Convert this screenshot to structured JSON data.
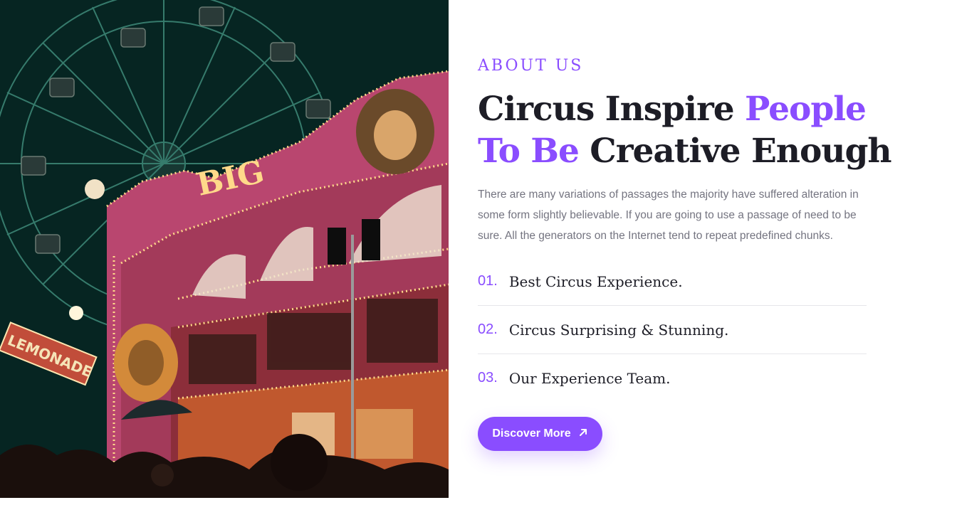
{
  "about": {
    "eyebrow": "ABOUT US",
    "heading_part1": "Circus Inspire ",
    "heading_accent1": "People",
    "heading_accent2": "To Be",
    "heading_part2": " Creative Enough",
    "description": "There are many variations of passages the majority have suffered alteration in some form slightly believable. If you are going to use a passage of need to be sure. All the generators on the Internet tend to repeat predefined chunks.",
    "items": [
      {
        "num": "01.",
        "label": "Best Circus Experience."
      },
      {
        "num": "02.",
        "label": "Circus Surprising & Stunning."
      },
      {
        "num": "03.",
        "label": "Our Experience Team."
      }
    ],
    "button_label": "Discover More",
    "button_icon": "arrow-up-right-icon"
  },
  "photo": {
    "sign_big": "BIG",
    "sign_lemonade": "LEMONADE"
  },
  "colors": {
    "accent": "#8a4dff",
    "heading": "#1d1d26",
    "body_text": "#747480"
  }
}
